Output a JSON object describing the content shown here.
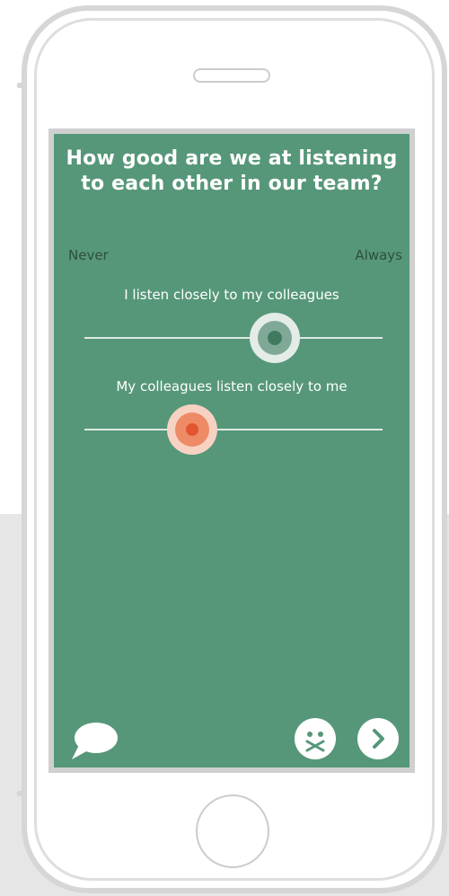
{
  "survey": {
    "question": "How good are we at listening to each other in our team?",
    "scale": {
      "min_label": "Never",
      "max_label": "Always"
    },
    "items": [
      {
        "label": "I listen closely to my colleagues",
        "value": 0.64,
        "color": "#3f7a5f"
      },
      {
        "label": "My colleagues listen closely to me",
        "value": 0.36,
        "color": "#e3552f"
      }
    ]
  },
  "colors": {
    "background": "#569779",
    "track": "#dfe9e4",
    "text": "#ffffff",
    "scale_text": "#2f4f40"
  },
  "footer": {
    "comment_icon": "speech-bubble-icon",
    "skip_icon": "gagged-face-icon",
    "next_icon": "chevron-right-icon"
  }
}
